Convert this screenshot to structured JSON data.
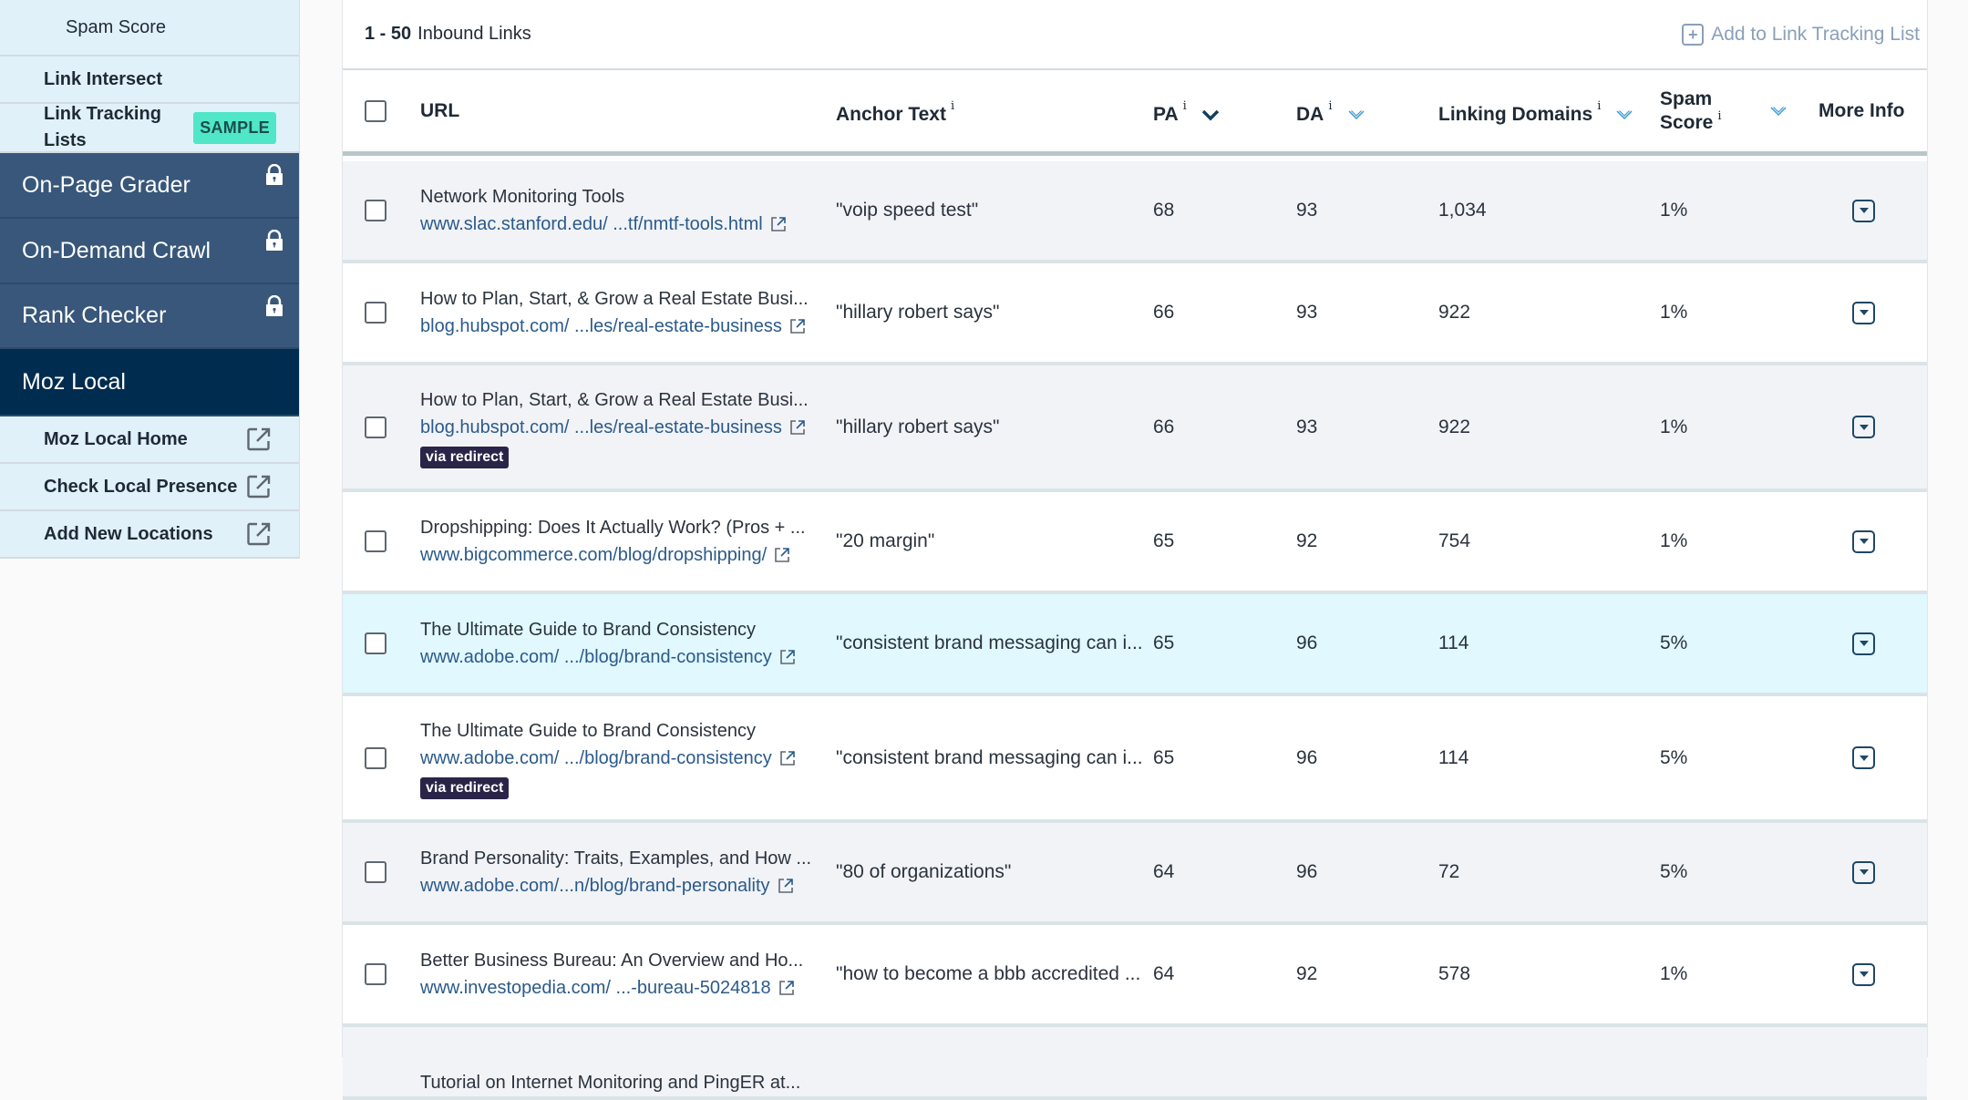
{
  "sidebar": {
    "items": [
      {
        "label": "Spam Score",
        "type": "sub",
        "bold": false
      },
      {
        "label": "Link Intersect",
        "type": "sub",
        "bold": true
      },
      {
        "label": "Link Tracking Lists",
        "type": "sub",
        "bold": true,
        "badge": "SAMPLE"
      },
      {
        "label": "On-Page Grader",
        "type": "main",
        "locked": true
      },
      {
        "label": "On-Demand Crawl",
        "type": "main",
        "locked": true
      },
      {
        "label": "Rank Checker",
        "type": "main",
        "locked": true
      },
      {
        "label": "Moz Local",
        "type": "main",
        "active": true
      },
      {
        "label": "Moz Local Home",
        "type": "sub",
        "bold": true,
        "external": true
      },
      {
        "label": "Check Local Presence",
        "type": "sub",
        "bold": true,
        "external": true
      },
      {
        "label": "Add New Locations",
        "type": "sub",
        "bold": true,
        "external": true
      }
    ]
  },
  "toolbar": {
    "range": "1 - 50",
    "range_label": "Inbound Links",
    "add_tracking_label": "Add to Link Tracking List"
  },
  "table": {
    "columns": {
      "url": "URL",
      "anchor": "Anchor Text",
      "pa": "PA",
      "da": "DA",
      "linking_domains": "Linking Domains",
      "spam_line1": "Spam",
      "spam_line2": "Score",
      "more_info": "More Info",
      "info_glyph": "i"
    },
    "sorted_by": "PA",
    "rows": [
      {
        "title": "Network Monitoring Tools",
        "url": "www.slac.stanford.edu/  ...tf/nmtf-tools.html",
        "anchor": "\"voip speed test\"",
        "pa": "68",
        "da": "93",
        "ld": "1,034",
        "spam": "1%",
        "redirect": false,
        "style": "alt"
      },
      {
        "title": "How to Plan, Start, & Grow a Real Estate Busi...",
        "url": "blog.hubspot.com/ ...les/real-estate-business",
        "anchor": "\"hillary robert says\"",
        "pa": "66",
        "da": "93",
        "ld": "922",
        "spam": "1%",
        "redirect": false,
        "style": "white"
      },
      {
        "title": "How to Plan, Start, & Grow a Real Estate Busi...",
        "url": "blog.hubspot.com/ ...les/real-estate-business",
        "anchor": "\"hillary robert says\"",
        "pa": "66",
        "da": "93",
        "ld": "922",
        "spam": "1%",
        "redirect": true,
        "style": "alt"
      },
      {
        "title": "Dropshipping: Does It Actually Work? (Pros + ...",
        "url": "www.bigcommerce.com/blog/dropshipping/",
        "anchor": "\"20 margin\"",
        "pa": "65",
        "da": "92",
        "ld": "754",
        "spam": "1%",
        "redirect": false,
        "style": "white"
      },
      {
        "title": "The Ultimate Guide to Brand Consistency",
        "url": "www.adobe.com/  .../blog/brand-consistency",
        "anchor": "\"consistent brand messaging can i...",
        "pa": "65",
        "da": "96",
        "ld": "114",
        "spam": "5%",
        "redirect": false,
        "style": "hl"
      },
      {
        "title": "The Ultimate Guide to Brand Consistency",
        "url": "www.adobe.com/  .../blog/brand-consistency",
        "anchor": "\"consistent brand messaging can i...",
        "pa": "65",
        "da": "96",
        "ld": "114",
        "spam": "5%",
        "redirect": true,
        "style": "white"
      },
      {
        "title": "Brand Personality: Traits, Examples, and How ...",
        "url": "www.adobe.com/...n/blog/brand-personality",
        "anchor": "\"80 of organizations\"",
        "pa": "64",
        "da": "96",
        "ld": "72",
        "spam": "5%",
        "redirect": false,
        "style": "alt"
      },
      {
        "title": "Better Business Bureau: An Overview and Ho...",
        "url": "www.investopedia.com/  ...-bureau-5024818",
        "anchor": "\"how to become a bbb accredited ...",
        "pa": "64",
        "da": "92",
        "ld": "578",
        "spam": "1%",
        "redirect": false,
        "style": "white"
      },
      {
        "title": "Tutorial on Internet Monitoring and PingER at...",
        "url": "",
        "anchor": "",
        "pa": "",
        "da": "",
        "ld": "",
        "spam": "",
        "redirect": false,
        "style": "alt",
        "partial": true
      }
    ],
    "redirect_label": "via redirect"
  },
  "colors": {
    "sidebar_sub_bg": "#e1f1fa",
    "sidebar_main_bg": "#38577a",
    "sidebar_active_bg": "#002d4f",
    "sample_badge": "#4fe7c8",
    "link": "#2b5a8a",
    "redirect_badge": "#2a2548",
    "row_highlight": "#e0f8fe",
    "row_alt": "#f1f3f7"
  }
}
